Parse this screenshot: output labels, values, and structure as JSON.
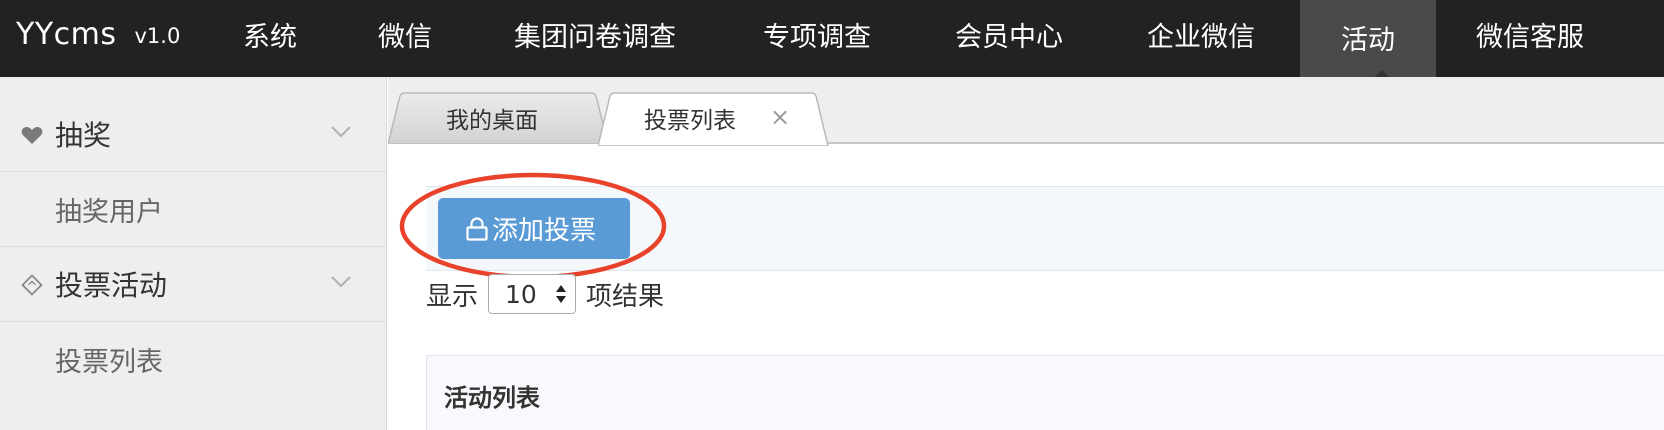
{
  "header": {
    "brand": "YYcms",
    "version": "v1.0",
    "nav": [
      {
        "label": "系统"
      },
      {
        "label": "微信"
      },
      {
        "label": "集团问卷调查"
      },
      {
        "label": "专项调查"
      },
      {
        "label": "会员中心"
      },
      {
        "label": "企业微信"
      },
      {
        "label": "活动",
        "active": true
      },
      {
        "label": "微信客服"
      }
    ]
  },
  "sidebar": {
    "groups": [
      {
        "label": "抽奖",
        "icon": "heart-icon",
        "items": [
          {
            "label": "抽奖用户"
          }
        ]
      },
      {
        "label": "投票活动",
        "icon": "tag-icon",
        "items": [
          {
            "label": "投票列表"
          }
        ]
      }
    ]
  },
  "tabs": [
    {
      "label": "我的桌面",
      "active": false
    },
    {
      "label": "投票列表",
      "active": true,
      "close": "×"
    }
  ],
  "toolbar": {
    "add_label": "添加投票",
    "add_icon": "lock-icon"
  },
  "length": {
    "prefix": "显示",
    "value": "10",
    "suffix": "项结果"
  },
  "panel": {
    "title": "活动列表"
  },
  "colors": {
    "topbar": "#222222",
    "topbar_active": "#4a4a4a",
    "sidebar": "#eeeeee",
    "button": "#5b9bd5",
    "annotation": "#e8432a"
  }
}
